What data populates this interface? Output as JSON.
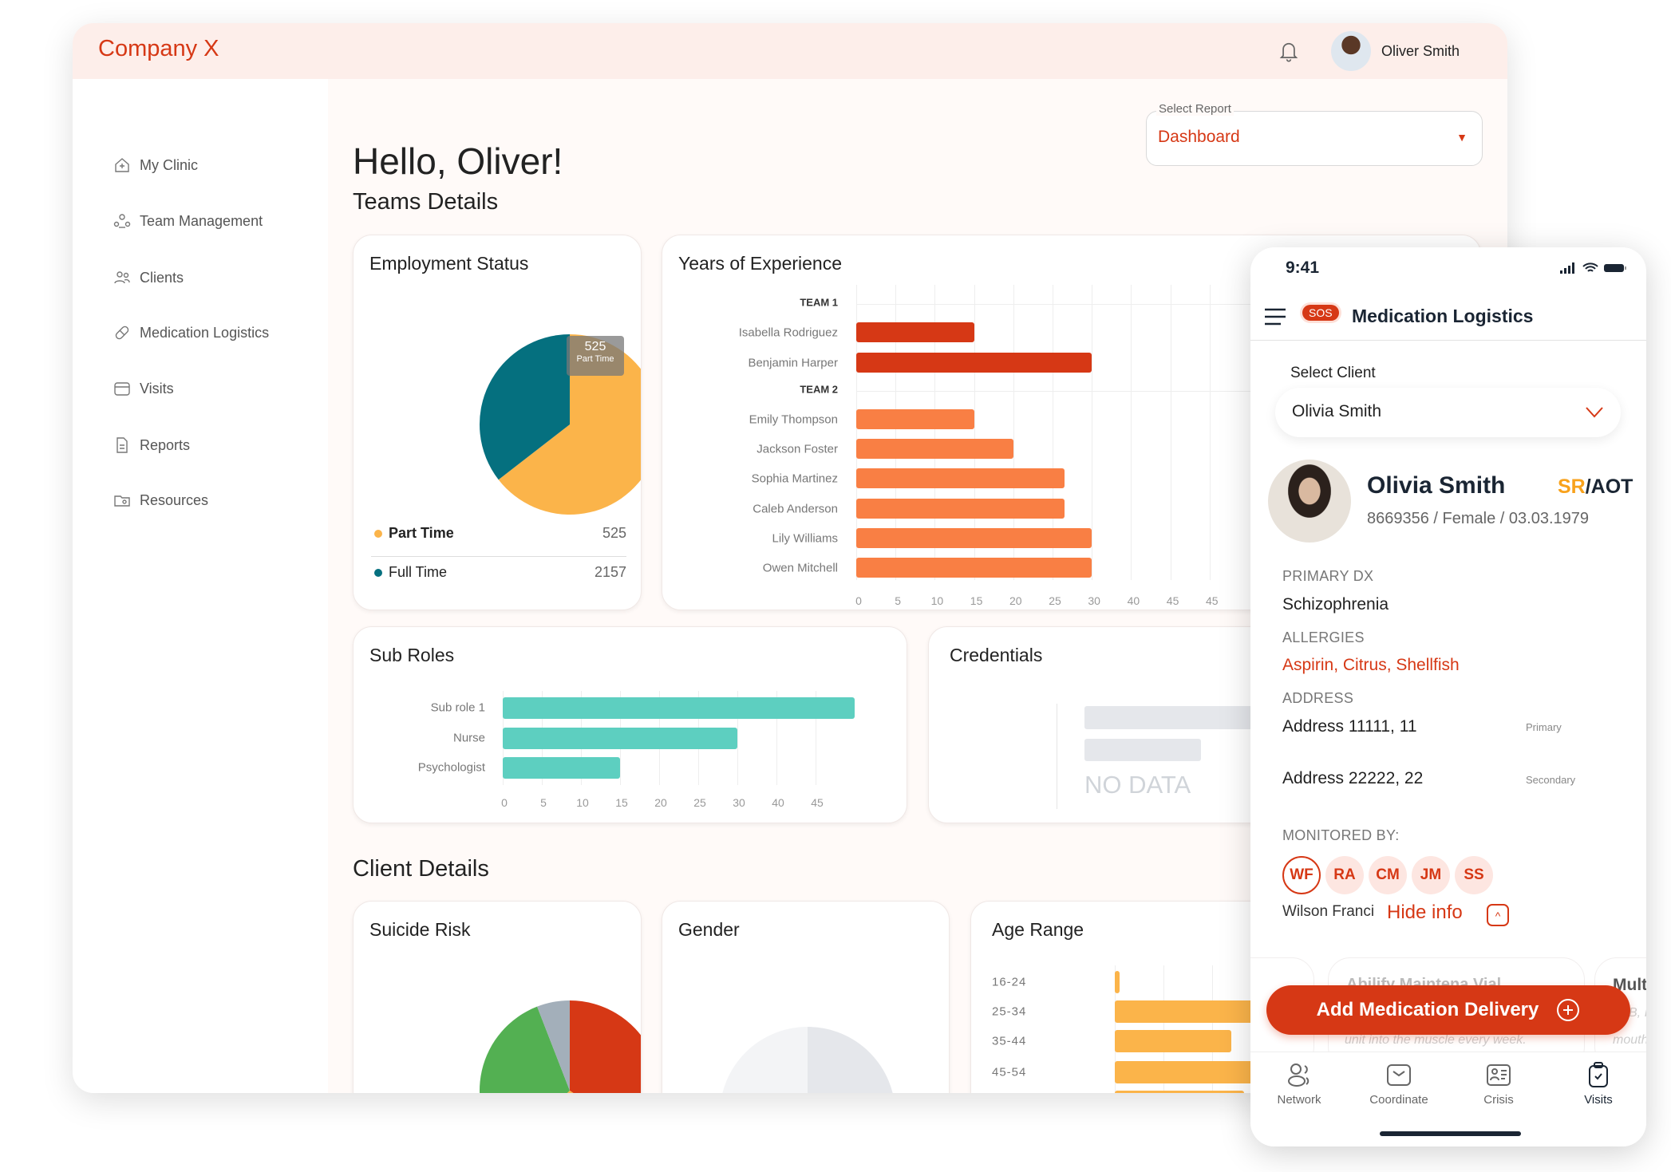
{
  "header": {
    "brand": "Company X",
    "user_name": "Oliver Smith",
    "bell_icon": "bell-icon"
  },
  "sidebar": {
    "items": [
      {
        "label": "My Clinic",
        "icon": "home-icon"
      },
      {
        "label": "Team Management",
        "icon": "team-icon"
      },
      {
        "label": "Clients",
        "icon": "users-icon"
      },
      {
        "label": "Medication Logistics",
        "icon": "pill-icon"
      },
      {
        "label": "Visits",
        "icon": "calendar-icon"
      },
      {
        "label": "Reports",
        "icon": "document-icon"
      },
      {
        "label": "Resources",
        "icon": "folder-icon"
      }
    ]
  },
  "main": {
    "greeting": "Hello, Oliver!",
    "select_report": {
      "label": "Select Report",
      "value": "Dashboard"
    },
    "teams_heading": "Teams Details",
    "client_heading": "Client Details",
    "credentials": {
      "title": "Credentials",
      "empty_text": "NO DATA"
    },
    "gender": {
      "title": "Gender"
    }
  },
  "colors": {
    "accent": "#d63815",
    "part_time": "#fbb44a",
    "full_time": "#05707f",
    "team1": "#d63815",
    "team2": "#f97f44",
    "sub_roles": "#5dcfc0",
    "age": "#fbb44a"
  },
  "chart_data": [
    {
      "type": "pie",
      "title": "Employment Status",
      "legend": [
        {
          "name": "Part Time",
          "value": "525"
        },
        {
          "name": "Full Time",
          "value": "2157"
        }
      ],
      "slice_share": [
        0.645,
        0.355
      ],
      "tooltip": {
        "value": "525",
        "label": "Part Time"
      }
    },
    {
      "type": "bar",
      "orientation": "horizontal",
      "title": "Years of Experience",
      "groups": [
        {
          "name": "TEAM 1",
          "rows": [
            {
              "label": "Isabella Rodriguez",
              "value": 15
            },
            {
              "label": "Benjamin Harper",
              "value": 30
            }
          ]
        },
        {
          "name": "TEAM 2",
          "rows": [
            {
              "label": "Emily Thompson",
              "value": 15
            },
            {
              "label": "Jackson Foster",
              "value": 20
            },
            {
              "label": "Sophia Martinez",
              "value": 26.5
            },
            {
              "label": "Caleb Anderson",
              "value": 26.5
            },
            {
              "label": "Lily Williams",
              "value": 30
            },
            {
              "label": "Owen Mitchell",
              "value": 30
            }
          ]
        }
      ],
      "xticks": [
        "0",
        "5",
        "10",
        "15",
        "20",
        "25",
        "30",
        "40",
        "45",
        "45"
      ],
      "grid": true
    },
    {
      "type": "bar",
      "orientation": "horizontal",
      "title": "Sub Roles",
      "categories": [
        "Sub role 1",
        "Nurse",
        "Psychologist"
      ],
      "values": [
        45,
        30,
        15
      ],
      "xticks": [
        "0",
        "5",
        "10",
        "15",
        "20",
        "25",
        "30",
        "40",
        "45"
      ],
      "xlim": [
        0,
        45
      ],
      "grid": true
    },
    {
      "type": "pie",
      "title": "Suicide Risk",
      "slice_share": [
        0.344,
        0.286,
        0.311,
        0.059
      ],
      "colors": [
        "#d63815",
        "#fbb44a",
        "#53b052",
        "#a3afba"
      ]
    },
    {
      "type": "bar",
      "orientation": "horizontal",
      "title": "Age Range",
      "categories": [
        "16-24",
        "25-34",
        "35-44",
        "45-54",
        ""
      ],
      "values": [
        0.1,
        5,
        2.4,
        5,
        2.65
      ],
      "grid": true
    }
  ],
  "phone": {
    "time": "9:41",
    "sos": "SOS",
    "title": "Medication Logistics",
    "select_client_label": "Select Client",
    "select_client_value": "Olivia Smith",
    "client": {
      "name": "Olivia Smith",
      "tag_sr": "SR",
      "tag_rest": "/AOT",
      "details": "8669356 / Female / 03.03.1979"
    },
    "primary_dx_label": "PRIMARY DX",
    "primary_dx": "Schizophrenia",
    "allergies_label": "ALLERGIES",
    "allergies": "Aspirin, Citrus, Shellfish",
    "address_label": "ADDRESS",
    "addresses": [
      {
        "value": "Address 11111, 11",
        "type": "Primary"
      },
      {
        "value": "Address 22222, 22",
        "type": "Secondary"
      }
    ],
    "monitored_label": "MONITORED BY:",
    "monitors": [
      "WF",
      "RA",
      "CM",
      "JM",
      "SS"
    ],
    "monitor_selected_name": "Wilson Franci",
    "hide_info": "Hide info",
    "med_card": {
      "title": "Abilify Maintena Vial",
      "desc": "unit into the muscle every week."
    },
    "med_card2": {
      "title": "Multi",
      "desc1": "B, I",
      "desc2": "mouth"
    },
    "add_button": "Add Medication Delivery",
    "tabs": [
      {
        "label": "Network"
      },
      {
        "label": "Coordinate"
      },
      {
        "label": "Crisis"
      },
      {
        "label": "Visits",
        "active": true
      }
    ]
  }
}
